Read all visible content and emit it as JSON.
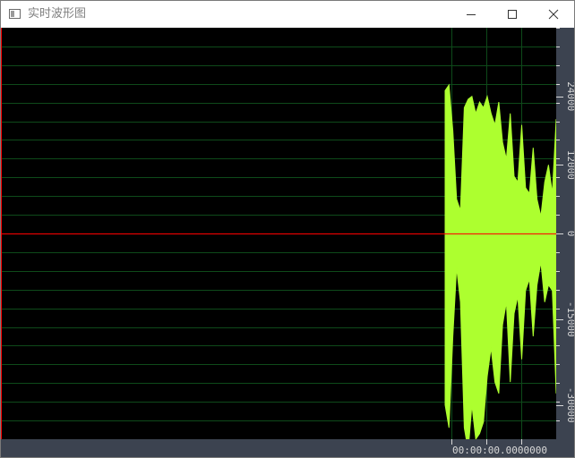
{
  "window": {
    "title": "实时波形图",
    "icons": {
      "app": "app-window-icon",
      "minimize": "minimize-icon",
      "maximize": "maximize-icon",
      "close": "close-icon"
    }
  },
  "chart_data": {
    "type": "line",
    "y_ticks": [
      24000,
      12000,
      0,
      -15000,
      -30000
    ],
    "y_tick_labels": [
      "24000",
      "12000",
      "0",
      "-15000",
      "-30000"
    ],
    "ylim": [
      -36000,
      36000
    ],
    "x_label": "00:00:00.0000000",
    "grid": true,
    "colors": {
      "background": "#000000",
      "grid": "#0e4a1a",
      "waveform": "#adff2f",
      "zero_line": "#ff0000",
      "start_marker": "#ff0000",
      "axis_panel": "#3c4350",
      "axis_text": "#d8d8d8"
    },
    "waveform": {
      "x_start": 0.8,
      "x_end": 1.0,
      "samples_top": [
        25000,
        26000,
        18000,
        6000,
        4000,
        22000,
        23500,
        24000,
        21000,
        23000,
        22000,
        24000,
        21000,
        19000,
        23000,
        16000,
        13000,
        21000,
        10000,
        9000,
        19000,
        8000,
        7000,
        15000,
        6000,
        3000,
        9000,
        12000,
        7000,
        20000
      ],
      "samples_bottom": [
        -30000,
        -34000,
        -18000,
        -6000,
        -12000,
        -34000,
        -38000,
        -30000,
        -36000,
        -35000,
        -33000,
        -25000,
        -20000,
        -26000,
        -28000,
        -16000,
        -12000,
        -26000,
        -14000,
        -11000,
        -22000,
        -10000,
        -8000,
        -18000,
        -9000,
        -5000,
        -12000,
        -9000,
        -10000,
        -28000
      ]
    }
  }
}
